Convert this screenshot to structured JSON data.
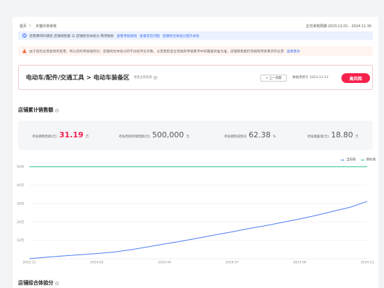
{
  "header": {
    "breadcrumb": [
      "首页",
      "天猫日常考核"
    ],
    "period": "正式考核周期 2023.12.01 - 2024.11.30"
  },
  "info_bar": {
    "text": "您需要同时满足 店铺销售额 与 店铺综合体验分 两项指标",
    "links": [
      "查看考核规则",
      "查看常见问题",
      "店铺综合体验分提升体系"
    ]
  },
  "warn_bar": {
    "text": "由于您的主营类目有变更，所以您的考核规则为：店铺综合体验分的不达标月份次数，以变更前后主营类目考核要求中的最宽标准为准，店铺销售额仍然按照考核要求的主营",
    "link": "查看更多"
  },
  "category": {
    "title": "电动车/配件/交通工具 > 电动车装备区",
    "sub": "考核主营类目",
    "prev_button": "< 上一周期",
    "update": "数据更新于 2024-11-23",
    "risk_button": "高风险"
  },
  "sales_section": {
    "title": "店铺累计销售额",
    "metrics": [
      {
        "label": "考核期销售额(元)",
        "value": "31.19",
        "unit": "万",
        "highlight": true
      },
      {
        "label": "考核周目标销售额(元)",
        "value": "500,000",
        "unit": "元",
        "highlight": false
      },
      {
        "label": "考核期完成情况",
        "value": "62.38",
        "unit": "%",
        "highlight": false
      },
      {
        "label": "考核期差值(元)",
        "value": "18.80",
        "unit": "万",
        "highlight": false
      }
    ]
  },
  "score_section": {
    "title": "店铺综合体验分"
  },
  "colors": {
    "accent": "#3b6ff5",
    "danger": "#f5224e",
    "target": "#1fbf8f",
    "current": "#4a7cf0"
  },
  "chart_data": {
    "type": "line",
    "title": "",
    "xlabel": "",
    "ylabel": "",
    "x_ticks": [
      "2023.12",
      "2024.02",
      "2024.04",
      "2024.07",
      "2024.09",
      "2024.11"
    ],
    "y_ticks": [
      "10万",
      "20万",
      "30万",
      "40万",
      "50万"
    ],
    "ylim": [
      0,
      50
    ],
    "legend": [
      "当前值",
      "目标值"
    ],
    "legend_position": "top-right",
    "series": [
      {
        "name": "当前值",
        "x": [
          0,
          0.05,
          0.1,
          0.15,
          0.2,
          0.25,
          0.3,
          0.35,
          0.4,
          0.45,
          0.5,
          0.55,
          0.6,
          0.65,
          0.7,
          0.75,
          0.8,
          0.85,
          0.9,
          0.95,
          1.0
        ],
        "values": [
          0,
          0.8,
          1.5,
          2.2,
          2.8,
          3.6,
          4.9,
          6.4,
          8.0,
          9.5,
          11.2,
          12.9,
          14.6,
          16.4,
          18.0,
          19.8,
          21.6,
          23.6,
          25.8,
          28.0,
          31.19
        ]
      },
      {
        "name": "目标值",
        "x": [
          0,
          1.0
        ],
        "values": [
          50,
          50
        ]
      }
    ]
  }
}
